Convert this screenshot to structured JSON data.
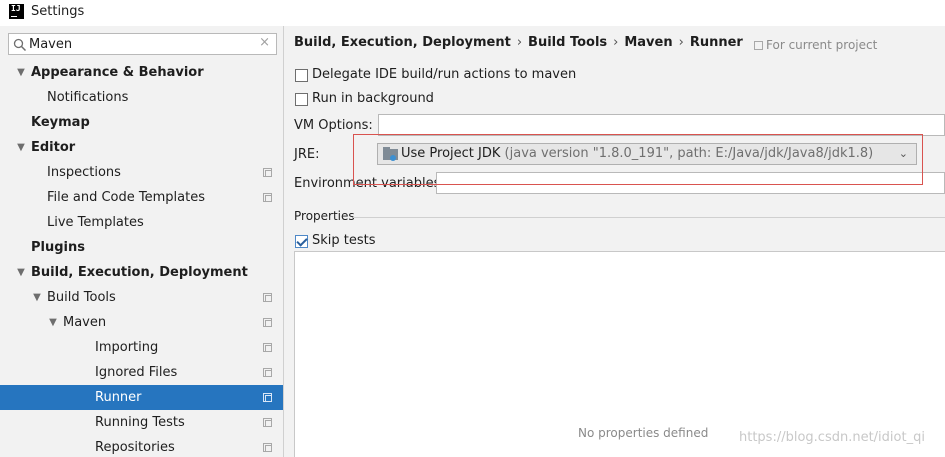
{
  "window": {
    "title": "Settings",
    "app_icon": "intellij-idea-icon"
  },
  "search": {
    "value": "Maven",
    "clear_label": "×"
  },
  "tree": [
    {
      "label": "Appearance & Behavior",
      "level": 0,
      "bold": true,
      "expanded": true
    },
    {
      "label": "Notifications",
      "level": 1
    },
    {
      "label": "Keymap",
      "level": 0,
      "bold": true
    },
    {
      "label": "Editor",
      "level": 0,
      "bold": true,
      "expanded": true
    },
    {
      "label": "Inspections",
      "level": 1,
      "project": true
    },
    {
      "label": "File and Code Templates",
      "level": 1,
      "project": true
    },
    {
      "label": "Live Templates",
      "level": 1
    },
    {
      "label": "Plugins",
      "level": 0,
      "bold": true
    },
    {
      "label": "Build, Execution, Deployment",
      "level": 0,
      "bold": true,
      "expanded": true
    },
    {
      "label": "Build Tools",
      "level": 1,
      "expanded": true,
      "project": true
    },
    {
      "label": "Maven",
      "level": 2,
      "expanded": true,
      "project": true
    },
    {
      "label": "Importing",
      "level": 3,
      "project": true
    },
    {
      "label": "Ignored Files",
      "level": 3,
      "project": true
    },
    {
      "label": "Runner",
      "level": 3,
      "project": true,
      "selected": true
    },
    {
      "label": "Running Tests",
      "level": 3,
      "project": true
    },
    {
      "label": "Repositories",
      "level": 3,
      "project": true
    }
  ],
  "breadcrumb": [
    "Build, Execution, Deployment",
    "Build Tools",
    "Maven",
    "Runner"
  ],
  "breadcrumb_sep": "›",
  "scope_label": "For current project",
  "options": {
    "delegate_label": "Delegate IDE build/run actions to maven",
    "delegate_checked": false,
    "background_label": "Run in background",
    "background_checked": false
  },
  "vm_options": {
    "label": "VM Options:",
    "value": ""
  },
  "jre": {
    "label": "JRE:",
    "selected": "Use Project JDK",
    "hint": "(java version \"1.8.0_191\", path: E:/Java/jdk/Java8/jdk1.8)"
  },
  "env_vars": {
    "label": "Environment variables:",
    "value": ""
  },
  "properties": {
    "title": "Properties",
    "skip_tests_label": "Skip tests",
    "skip_tests_checked": true,
    "empty_text": "No properties defined"
  },
  "watermark": "https://blog.csdn.net/idiot_qi",
  "colors": {
    "selection": "#2675bf",
    "highlight_box": "#d9534f"
  }
}
